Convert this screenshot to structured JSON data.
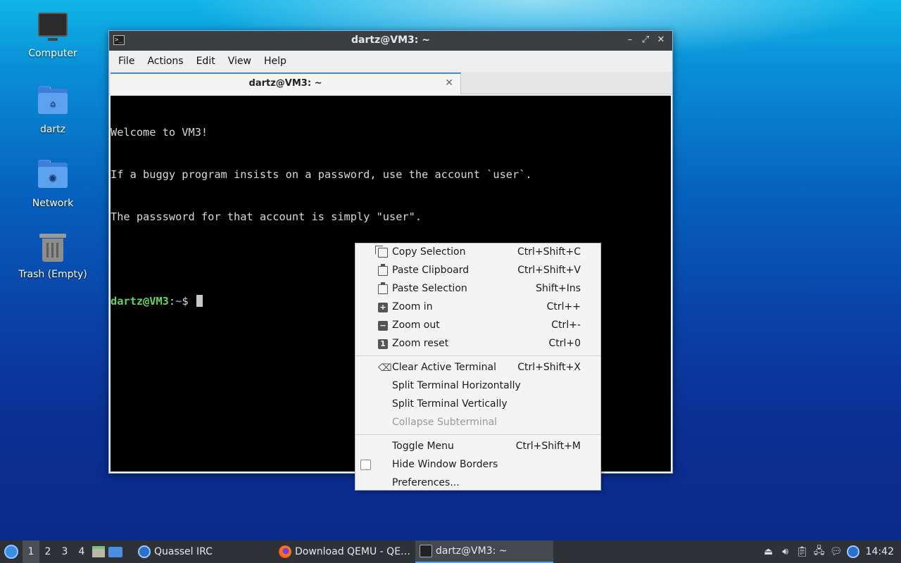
{
  "desktop": {
    "icons": [
      {
        "label": "Computer"
      },
      {
        "label": "dartz"
      },
      {
        "label": "Network"
      },
      {
        "label": "Trash (Empty)"
      }
    ]
  },
  "window": {
    "title": "dartz@VM3: ~",
    "app_icon": ">_",
    "controls": {
      "minimize": "–",
      "maximize": "⤢",
      "close": "✕"
    },
    "menu": [
      "File",
      "Actions",
      "Edit",
      "View",
      "Help"
    ],
    "tab": {
      "label": "dartz@VM3: ~",
      "close": "✕"
    }
  },
  "terminal": {
    "lines": [
      "Welcome to VM3!",
      "If a buggy program insists on a password, use the account `user`.",
      "The passsword for that account is simply \"user\".",
      ""
    ],
    "prompt": {
      "user_host": "dartz@VM3",
      "colon": ":",
      "path": "~",
      "symbol": "$ "
    }
  },
  "context_menu": {
    "items": [
      {
        "label": "Copy Selection",
        "shortcut": "Ctrl+Shift+C",
        "icon": "copy-icon"
      },
      {
        "label": "Paste Clipboard",
        "shortcut": "Ctrl+Shift+V",
        "icon": "paste-icon"
      },
      {
        "label": "Paste Selection",
        "shortcut": "Shift+Ins",
        "icon": "paste-icon"
      },
      {
        "label": "Zoom in",
        "shortcut": "Ctrl++",
        "icon": "zoom-in-icon"
      },
      {
        "label": "Zoom out",
        "shortcut": "Ctrl+-",
        "icon": "zoom-out-icon"
      },
      {
        "label": "Zoom reset",
        "shortcut": "Ctrl+0",
        "icon": "zoom-reset-icon"
      },
      {
        "label": "Clear Active Terminal",
        "shortcut": "Ctrl+Shift+X",
        "icon": "clear-icon"
      },
      {
        "label": "Split Terminal Horizontally",
        "shortcut": ""
      },
      {
        "label": "Split Terminal Vertically",
        "shortcut": ""
      },
      {
        "label": "Collapse Subterminal",
        "shortcut": "",
        "disabled": true
      },
      {
        "label": "Toggle Menu",
        "shortcut": "Ctrl+Shift+M"
      },
      {
        "label": "Hide Window Borders",
        "shortcut": "",
        "checkbox": false
      },
      {
        "label": "Preferences...",
        "shortcut": ""
      }
    ]
  },
  "taskbar": {
    "workspaces": [
      "1",
      "2",
      "3",
      "4"
    ],
    "active_workspace": "1",
    "tasks": [
      {
        "label": "Quassel IRC"
      },
      {
        "label": "Download QEMU - QE…"
      },
      {
        "label": "dartz@VM3: ~"
      }
    ],
    "clock": "14:42"
  }
}
